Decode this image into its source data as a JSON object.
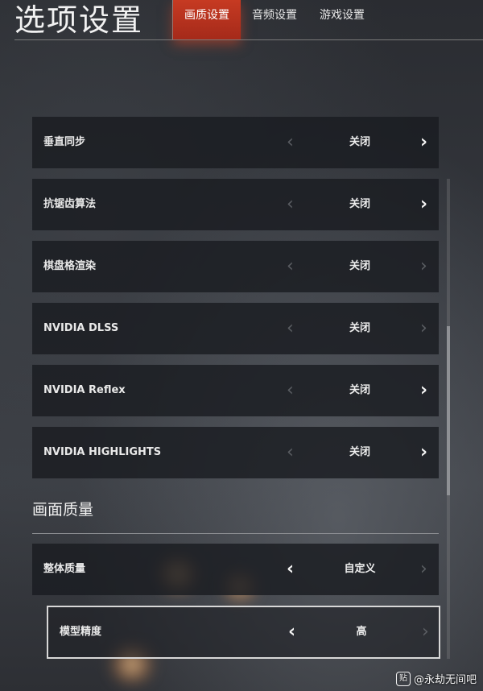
{
  "header": {
    "title": "选项设置",
    "tabs": [
      {
        "label": "画质设置",
        "active": true
      },
      {
        "label": "音频设置",
        "active": false
      },
      {
        "label": "游戏设置",
        "active": false
      }
    ]
  },
  "settings": [
    {
      "label": "垂直同步",
      "value": "关闭",
      "left_enabled": false,
      "right_enabled": true
    },
    {
      "label": "抗锯齿算法",
      "value": "关闭",
      "left_enabled": false,
      "right_enabled": true
    },
    {
      "label": "棋盘格渲染",
      "value": "关闭",
      "left_enabled": false,
      "right_enabled": false
    },
    {
      "label": "NVIDIA DLSS",
      "value": "关闭",
      "left_enabled": false,
      "right_enabled": false
    },
    {
      "label": "NVIDIA Reflex",
      "value": "关闭",
      "left_enabled": false,
      "right_enabled": true
    },
    {
      "label": "NVIDIA HIGHLIGHTS",
      "value": "关闭",
      "left_enabled": false,
      "right_enabled": true
    }
  ],
  "quality_section": {
    "title": "画面质量",
    "items": [
      {
        "label": "整体质量",
        "value": "自定义",
        "left_enabled": true,
        "right_enabled": false
      },
      {
        "label": "模型精度",
        "value": "高",
        "left_enabled": true,
        "right_enabled": false,
        "selected": true
      }
    ]
  },
  "icons": {
    "left_arrow": "chevron-left-icon",
    "right_arrow": "chevron-right-icon"
  },
  "colors": {
    "accent": "#c63a22",
    "row_bg": "#1a1c21"
  },
  "watermark": {
    "text": "@永劫无间吧",
    "icon_glyph": "贴"
  }
}
